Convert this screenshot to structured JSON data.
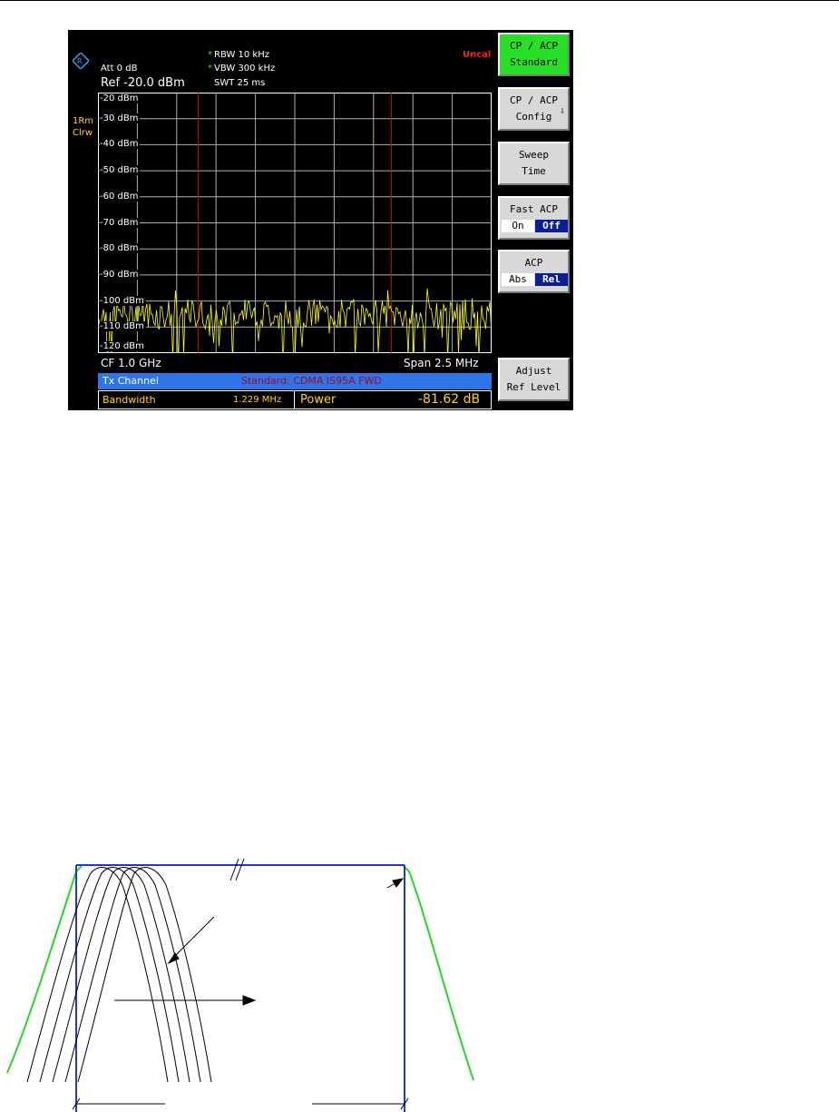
{
  "analyzer": {
    "rbw": "RBW 10 kHz",
    "vbw": "VBW 300 kHz",
    "swt": "SWT 25 ms",
    "att": "Att  0 dB",
    "ref": "Ref -20.0 dBm",
    "uncal": "Uncal",
    "trace_label_1": "1Rm",
    "trace_label_2": "Clrw",
    "cf": "CF 1.0 GHz",
    "span": "Span 2.5 MHz",
    "y_levels": [
      "-20 dBm",
      "-30 dBm",
      "-40 dBm",
      "-50 dBm",
      "-60 dBm",
      "-70 dBm",
      "-80 dBm",
      "-90 dBm",
      "-100 dBm",
      "-110 dBm",
      "-120 dBm"
    ],
    "table": {
      "channel": "Tx Channel",
      "standard": "Standard: CDMA IS95A FWD",
      "bandwidth_label": "Bandwidth",
      "bandwidth_value": "1.229 MHz",
      "power_label": "Power",
      "power_value": "-81.62 dB"
    },
    "colors": {
      "trace": "#ffff00",
      "marker_lines": "#c01010",
      "active_key": "#29e029",
      "selected_toggle": "#0a1e9a"
    }
  },
  "softkeys": [
    {
      "line1": "CP / ACP",
      "line2": "Standard",
      "active": true
    },
    {
      "line1": "CP / ACP",
      "line2": "Config",
      "submenu": true
    },
    {
      "line1": "Sweep",
      "line2": "Time"
    },
    {
      "line1": "Fast ACP",
      "opt_a": "On",
      "opt_b": "Off",
      "selected": "Off"
    },
    {
      "line1": "ACP",
      "opt_a": "Abs",
      "opt_b": "Rel",
      "selected": "Rel"
    },
    {
      "line1": "Adjust",
      "line2": "Ref Level"
    }
  ]
}
